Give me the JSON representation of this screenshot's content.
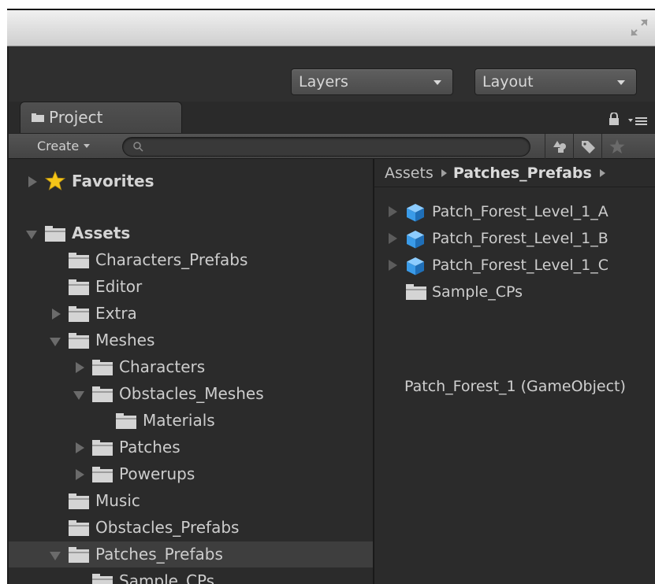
{
  "toolbar": {
    "layers_label": "Layers",
    "layout_label": "Layout"
  },
  "tab": {
    "label": "Project"
  },
  "project_toolbar": {
    "create_label": "Create",
    "search_placeholder": ""
  },
  "tree": {
    "favorites_label": "Favorites",
    "assets_label": "Assets",
    "items": [
      {
        "label": "Characters_Prefabs"
      },
      {
        "label": "Editor"
      },
      {
        "label": "Extra"
      },
      {
        "label": "Meshes"
      },
      {
        "label": "Characters"
      },
      {
        "label": "Obstacles_Meshes"
      },
      {
        "label": "Materials"
      },
      {
        "label": "Patches"
      },
      {
        "label": "Powerups"
      },
      {
        "label": "Music"
      },
      {
        "label": "Obstacles_Prefabs"
      },
      {
        "label": "Patches_Prefabs"
      },
      {
        "label": "Sample_CPs"
      }
    ]
  },
  "breadcrumb": {
    "root": "Assets",
    "current": "Patches_Prefabs"
  },
  "assets": [
    {
      "label": "Patch_Forest_Level_1_A",
      "icon": "prefab-cube-icon"
    },
    {
      "label": "Patch_Forest_Level_1_B",
      "icon": "prefab-cube-icon"
    },
    {
      "label": "Patch_Forest_Level_1_C",
      "icon": "prefab-cube-icon"
    },
    {
      "label": "Sample_CPs",
      "icon": "folder-icon"
    }
  ],
  "status": "Patch_Forest_1 (GameObject)",
  "colors": {
    "panel_bg": "#2b2b2b",
    "selected_row": "#3e3e3e",
    "cube_blue": "#3a9be8",
    "star_gold": "#f5c518"
  }
}
